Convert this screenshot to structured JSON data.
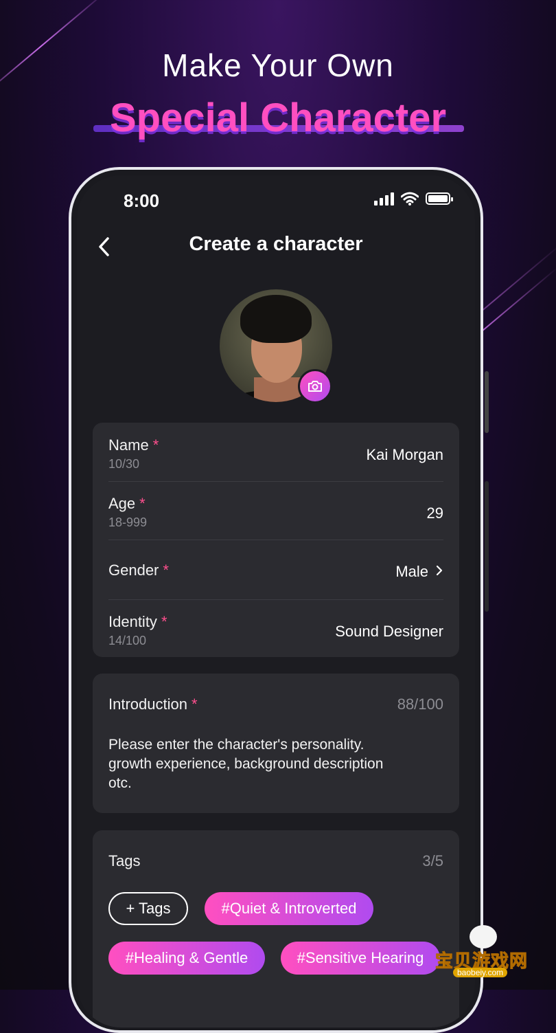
{
  "hero": {
    "line1": "Make Your Own",
    "line2": "Special Character"
  },
  "status_bar": {
    "time": "8:00"
  },
  "header": {
    "title": "Create a character"
  },
  "form": {
    "name": {
      "label": "Name",
      "required_mark": "*",
      "counter": "10/30",
      "value": "Kai Morgan"
    },
    "age": {
      "label": "Age",
      "required_mark": "*",
      "range": "18-999",
      "value": "29"
    },
    "gender": {
      "label": "Gender",
      "required_mark": "*",
      "value": "Male"
    },
    "identity": {
      "label": "Identity",
      "required_mark": "*",
      "counter": "14/100",
      "value": "Sound Designer"
    }
  },
  "introduction": {
    "label": "Introduction",
    "required_mark": "*",
    "counter": "88/100",
    "text": "Please enter the character's personality. growth experience, background description otc."
  },
  "tags": {
    "label": "Tags",
    "counter": "3/5",
    "add_label": "+ Tags",
    "items": [
      "#Quiet & Introverted",
      "#Healing & Gentle",
      "#Sensitive Hearing"
    ]
  },
  "watermark": {
    "text": "宝贝游戏网",
    "url": "baobeiy.com"
  },
  "colors": {
    "accent_pink": "#ff4fc0",
    "accent_purple": "#b04bef",
    "required_red": "#ff4f8e",
    "card_bg": "#2b2b30"
  }
}
